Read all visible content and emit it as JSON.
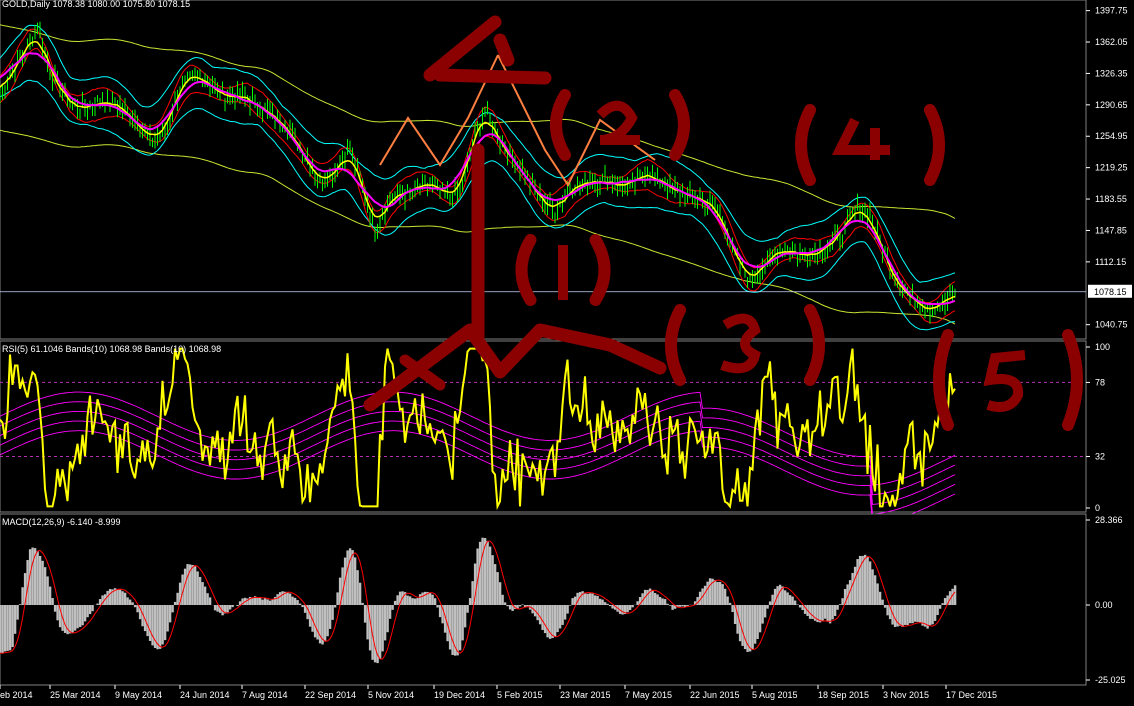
{
  "window": {
    "main_title": "GOLD,Daily  1078.38 1080.00 1075.80 1078.15",
    "rsi_title": "RSI(5) 61.1046  Bands(10) 1068.98  Bands(10) 1068.98",
    "macd_title": "MACD(12,26,9) -6.140 -8.999"
  },
  "colors": {
    "background": "#000000",
    "candle": "#00ff00",
    "ma_magenta": "#ff00ff",
    "ma_yellow": "#ffff00",
    "band_cyan": "#00ffff",
    "band_red": "#ff0000",
    "band_outer": "#c8e632",
    "rsi_line": "#ffff00",
    "rsi_bands": "#ff00ff",
    "macd_hist": "#c0c0c0",
    "macd_signal": "#ff0000",
    "annotation": "#8b0000",
    "arrow": "#ff7f3f",
    "price_line": "#c8d8ff"
  },
  "chart_data": [
    {
      "type": "candlestick",
      "name": "GOLD,Daily",
      "y_ticks": [
        "1397.75",
        "1362.05",
        "1326.35",
        "1290.65",
        "1254.95",
        "1219.25",
        "1183.55",
        "1147.85",
        "1112.15",
        "1078.15",
        "1040.75"
      ],
      "ylim": [
        1029.0,
        1403.0
      ],
      "current_price": "1078.15",
      "close_path": [
        {
          "x": 0,
          "y": 1300
        },
        {
          "x": 10,
          "y": 1325
        },
        {
          "x": 25,
          "y": 1350
        },
        {
          "x": 38,
          "y": 1380
        },
        {
          "x": 50,
          "y": 1330
        },
        {
          "x": 65,
          "y": 1300
        },
        {
          "x": 80,
          "y": 1285
        },
        {
          "x": 100,
          "y": 1295
        },
        {
          "x": 120,
          "y": 1290
        },
        {
          "x": 140,
          "y": 1270
        },
        {
          "x": 150,
          "y": 1250
        },
        {
          "x": 165,
          "y": 1260
        },
        {
          "x": 180,
          "y": 1310
        },
        {
          "x": 200,
          "y": 1325
        },
        {
          "x": 210,
          "y": 1315
        },
        {
          "x": 225,
          "y": 1300
        },
        {
          "x": 245,
          "y": 1300
        },
        {
          "x": 265,
          "y": 1285
        },
        {
          "x": 285,
          "y": 1270
        },
        {
          "x": 305,
          "y": 1235
        },
        {
          "x": 320,
          "y": 1205
        },
        {
          "x": 335,
          "y": 1215
        },
        {
          "x": 350,
          "y": 1240
        },
        {
          "x": 365,
          "y": 1190
        },
        {
          "x": 375,
          "y": 1150
        },
        {
          "x": 390,
          "y": 1185
        },
        {
          "x": 410,
          "y": 1190
        },
        {
          "x": 430,
          "y": 1200
        },
        {
          "x": 450,
          "y": 1185
        },
        {
          "x": 462,
          "y": 1195
        },
        {
          "x": 472,
          "y": 1245
        },
        {
          "x": 485,
          "y": 1285
        },
        {
          "x": 500,
          "y": 1250
        },
        {
          "x": 520,
          "y": 1220
        },
        {
          "x": 540,
          "y": 1185
        },
        {
          "x": 555,
          "y": 1170
        },
        {
          "x": 570,
          "y": 1195
        },
        {
          "x": 590,
          "y": 1205
        },
        {
          "x": 610,
          "y": 1205
        },
        {
          "x": 630,
          "y": 1195
        },
        {
          "x": 645,
          "y": 1215
        },
        {
          "x": 660,
          "y": 1205
        },
        {
          "x": 680,
          "y": 1190
        },
        {
          "x": 700,
          "y": 1185
        },
        {
          "x": 720,
          "y": 1170
        },
        {
          "x": 735,
          "y": 1120
        },
        {
          "x": 750,
          "y": 1090
        },
        {
          "x": 765,
          "y": 1110
        },
        {
          "x": 785,
          "y": 1130
        },
        {
          "x": 800,
          "y": 1120
        },
        {
          "x": 820,
          "y": 1125
        },
        {
          "x": 840,
          "y": 1140
        },
        {
          "x": 858,
          "y": 1175
        },
        {
          "x": 870,
          "y": 1165
        },
        {
          "x": 885,
          "y": 1120
        },
        {
          "x": 900,
          "y": 1085
        },
        {
          "x": 915,
          "y": 1070
        },
        {
          "x": 930,
          "y": 1060
        },
        {
          "x": 945,
          "y": 1065
        },
        {
          "x": 955,
          "y": 1078
        }
      ]
    },
    {
      "type": "line",
      "name": "RSI(5)",
      "y_ticks": [
        "100",
        "78",
        "32",
        "0"
      ],
      "ylim": [
        0,
        100
      ],
      "levels": [
        78,
        32
      ],
      "current": "61.1046",
      "bands_value": "1068.98"
    },
    {
      "type": "bar",
      "name": "MACD(12,26,9)",
      "y_ticks": [
        "28.366",
        "0.00",
        "-25.025"
      ],
      "ylim": [
        -25.025,
        28.366
      ],
      "macd": "-6.140",
      "signal": "-8.999"
    }
  ],
  "x_axis": {
    "labels": [
      "eb 2014",
      "25 Mar 2014",
      "9 May 2014",
      "24 Jun 2014",
      "7 Aug 2014",
      "22 Sep 2014",
      "5 Nov 2014",
      "19 Dec 2014",
      "5 Feb 2015",
      "23 Mar 2015",
      "7 May 2015",
      "22 Jun 2015",
      "5 Aug 2015",
      "18 Sep 2015",
      "3 Nov 2015",
      "17 Dec 2015"
    ]
  },
  "annotations": {
    "wave_labels": [
      "4",
      "(2)",
      "(4)",
      "(1)",
      "(3)",
      "(5)",
      "1"
    ]
  }
}
